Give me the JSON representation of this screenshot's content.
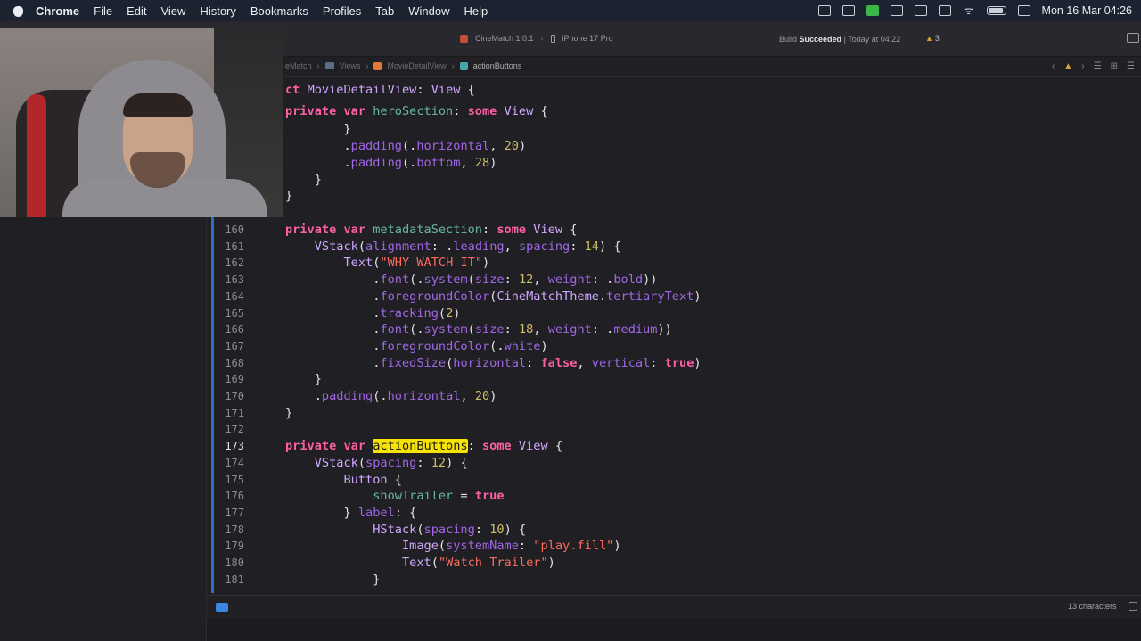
{
  "menubar": {
    "apple_icon": "apple-logo-icon",
    "items": [
      "Chrome",
      "File",
      "Edit",
      "View",
      "History",
      "Bookmarks",
      "Profiles",
      "Tab",
      "Window",
      "Help"
    ],
    "clock": "Mon 16 Mar  04:26"
  },
  "toolbar": {
    "scheme": "CineMatch 1.0.1",
    "device": "iPhone 17 Pro",
    "build_label": "Build",
    "build_result": "Succeeded",
    "build_time": "| Today at 04:22",
    "warnings": "3"
  },
  "jumpbar": {
    "crumbs": [
      "eMatch",
      "Views",
      "MovieDetailView",
      "actionButtons"
    ]
  },
  "code_top": [
    {
      "tokens": [
        [
          "kw",
          "ct "
        ],
        [
          "ty",
          "MovieDetailView"
        ],
        [
          "pl",
          ": "
        ],
        [
          "ty",
          "View"
        ],
        [
          "pl",
          " {"
        ]
      ]
    },
    {
      "tokens": [
        [
          "kw",
          "private var "
        ],
        [
          "id",
          "heroSection"
        ],
        [
          "pl",
          ": "
        ],
        [
          "kw",
          "some "
        ],
        [
          "ty",
          "View"
        ],
        [
          "pl",
          " {"
        ]
      ]
    },
    {
      "tokens": [
        [
          "pl",
          "        }"
        ]
      ]
    },
    {
      "tokens": [
        [
          "pl",
          "        ."
        ],
        [
          "fn",
          "padding"
        ],
        [
          "pl",
          "(."
        ],
        [
          "fn",
          "horizontal"
        ],
        [
          "pl",
          ", "
        ],
        [
          "num",
          "20"
        ],
        [
          "pl",
          ")"
        ]
      ]
    },
    {
      "tokens": [
        [
          "pl",
          "        ."
        ],
        [
          "fn",
          "padding"
        ],
        [
          "pl",
          "(."
        ],
        [
          "fn",
          "bottom"
        ],
        [
          "pl",
          ", "
        ],
        [
          "num",
          "28"
        ],
        [
          "pl",
          ")"
        ]
      ]
    },
    {
      "tokens": [
        [
          "pl",
          "    }"
        ]
      ]
    },
    {
      "tokens": [
        [
          "pl",
          "}"
        ]
      ]
    }
  ],
  "code_lines": [
    {
      "n": "160",
      "tokens": [
        [
          "kw",
          "private var "
        ],
        [
          "id",
          "metadataSection"
        ],
        [
          "pl",
          ": "
        ],
        [
          "kw",
          "some "
        ],
        [
          "ty",
          "View"
        ],
        [
          "pl",
          " {"
        ]
      ]
    },
    {
      "n": "161",
      "tokens": [
        [
          "pl",
          "    "
        ],
        [
          "ty",
          "VStack"
        ],
        [
          "pl",
          "("
        ],
        [
          "fn",
          "alignment"
        ],
        [
          "pl",
          ": ."
        ],
        [
          "fn",
          "leading"
        ],
        [
          "pl",
          ", "
        ],
        [
          "fn",
          "spacing"
        ],
        [
          "pl",
          ": "
        ],
        [
          "num",
          "14"
        ],
        [
          "pl",
          ") {"
        ]
      ]
    },
    {
      "n": "162",
      "tokens": [
        [
          "pl",
          "        "
        ],
        [
          "ty",
          "Text"
        ],
        [
          "pl",
          "("
        ],
        [
          "str",
          "\"WHY WATCH IT\""
        ],
        [
          "pl",
          ")"
        ]
      ]
    },
    {
      "n": "163",
      "tokens": [
        [
          "pl",
          "            ."
        ],
        [
          "fn",
          "font"
        ],
        [
          "pl",
          "(."
        ],
        [
          "fn",
          "system"
        ],
        [
          "pl",
          "("
        ],
        [
          "fn",
          "size"
        ],
        [
          "pl",
          ": "
        ],
        [
          "num",
          "12"
        ],
        [
          "pl",
          ", "
        ],
        [
          "fn",
          "weight"
        ],
        [
          "pl",
          ": ."
        ],
        [
          "fn",
          "bold"
        ],
        [
          "pl",
          "))"
        ]
      ]
    },
    {
      "n": "164",
      "tokens": [
        [
          "pl",
          "            ."
        ],
        [
          "fn",
          "foregroundColor"
        ],
        [
          "pl",
          "("
        ],
        [
          "ty",
          "CineMatchTheme"
        ],
        [
          "pl",
          "."
        ],
        [
          "fn",
          "tertiaryText"
        ],
        [
          "pl",
          ")"
        ]
      ]
    },
    {
      "n": "165",
      "tokens": [
        [
          "pl",
          "            ."
        ],
        [
          "fn",
          "tracking"
        ],
        [
          "pl",
          "("
        ],
        [
          "num",
          "2"
        ],
        [
          "pl",
          ")"
        ]
      ]
    },
    {
      "n": "166",
      "tokens": [
        [
          "pl",
          "            ."
        ],
        [
          "fn",
          "font"
        ],
        [
          "pl",
          "(."
        ],
        [
          "fn",
          "system"
        ],
        [
          "pl",
          "("
        ],
        [
          "fn",
          "size"
        ],
        [
          "pl",
          ": "
        ],
        [
          "num",
          "18"
        ],
        [
          "pl",
          ", "
        ],
        [
          "fn",
          "weight"
        ],
        [
          "pl",
          ": ."
        ],
        [
          "fn",
          "medium"
        ],
        [
          "pl",
          "))"
        ]
      ]
    },
    {
      "n": "167",
      "tokens": [
        [
          "pl",
          "            ."
        ],
        [
          "fn",
          "foregroundColor"
        ],
        [
          "pl",
          "(."
        ],
        [
          "fn",
          "white"
        ],
        [
          "pl",
          ")"
        ]
      ]
    },
    {
      "n": "168",
      "tokens": [
        [
          "pl",
          "            ."
        ],
        [
          "fn",
          "fixedSize"
        ],
        [
          "pl",
          "("
        ],
        [
          "fn",
          "horizontal"
        ],
        [
          "pl",
          ": "
        ],
        [
          "kw",
          "false"
        ],
        [
          "pl",
          ", "
        ],
        [
          "fn",
          "vertical"
        ],
        [
          "pl",
          ": "
        ],
        [
          "kw",
          "true"
        ],
        [
          "pl",
          ")"
        ]
      ]
    },
    {
      "n": "169",
      "tokens": [
        [
          "pl",
          "    }"
        ]
      ]
    },
    {
      "n": "170",
      "tokens": [
        [
          "pl",
          "    ."
        ],
        [
          "fn",
          "padding"
        ],
        [
          "pl",
          "(."
        ],
        [
          "fn",
          "horizontal"
        ],
        [
          "pl",
          ", "
        ],
        [
          "num",
          "20"
        ],
        [
          "pl",
          ")"
        ]
      ]
    },
    {
      "n": "171",
      "tokens": [
        [
          "pl",
          "}"
        ]
      ]
    },
    {
      "n": "172",
      "tokens": []
    },
    {
      "n": "173",
      "current": true,
      "tokens": [
        [
          "kw",
          "private var "
        ],
        [
          "hl",
          "actionButtons"
        ],
        [
          "pl",
          ": "
        ],
        [
          "kw",
          "some "
        ],
        [
          "ty",
          "View"
        ],
        [
          "pl",
          " {"
        ]
      ]
    },
    {
      "n": "174",
      "tokens": [
        [
          "pl",
          "    "
        ],
        [
          "ty",
          "VStack"
        ],
        [
          "pl",
          "("
        ],
        [
          "fn",
          "spacing"
        ],
        [
          "pl",
          ": "
        ],
        [
          "num",
          "12"
        ],
        [
          "pl",
          ") {"
        ]
      ]
    },
    {
      "n": "175",
      "tokens": [
        [
          "pl",
          "        "
        ],
        [
          "ty",
          "Button"
        ],
        [
          "pl",
          " {"
        ]
      ]
    },
    {
      "n": "176",
      "tokens": [
        [
          "pl",
          "            "
        ],
        [
          "id",
          "showTrailer"
        ],
        [
          "pl",
          " = "
        ],
        [
          "kw",
          "true"
        ]
      ]
    },
    {
      "n": "177",
      "tokens": [
        [
          "pl",
          "        } "
        ],
        [
          "fn",
          "label"
        ],
        [
          "pl",
          ": {"
        ]
      ]
    },
    {
      "n": "178",
      "tokens": [
        [
          "pl",
          "            "
        ],
        [
          "ty",
          "HStack"
        ],
        [
          "pl",
          "("
        ],
        [
          "fn",
          "spacing"
        ],
        [
          "pl",
          ": "
        ],
        [
          "num",
          "10"
        ],
        [
          "pl",
          ") {"
        ]
      ]
    },
    {
      "n": "179",
      "tokens": [
        [
          "pl",
          "                "
        ],
        [
          "ty",
          "Image"
        ],
        [
          "pl",
          "("
        ],
        [
          "fn",
          "systemName"
        ],
        [
          "pl",
          ": "
        ],
        [
          "str",
          "\"play.fill\""
        ],
        [
          "pl",
          ")"
        ]
      ]
    },
    {
      "n": "180",
      "tokens": [
        [
          "pl",
          "                "
        ],
        [
          "ty",
          "Text"
        ],
        [
          "pl",
          "("
        ],
        [
          "str",
          "\"Watch Trailer\""
        ],
        [
          "pl",
          ")"
        ]
      ]
    },
    {
      "n": "181",
      "tokens": [
        [
          "pl",
          "            }"
        ]
      ]
    }
  ],
  "status": {
    "char_count": "13 characters"
  }
}
